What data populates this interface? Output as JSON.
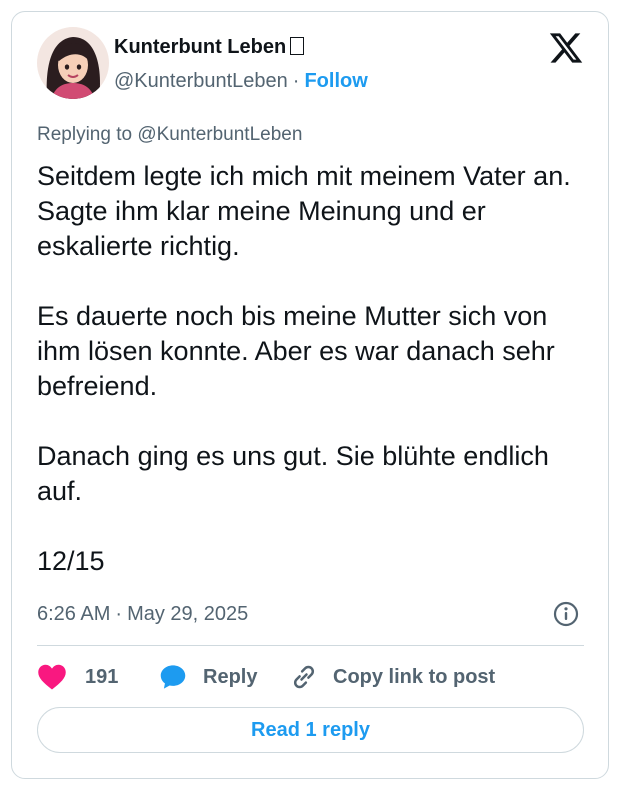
{
  "author": {
    "name": "Kunterbunt Leben",
    "handle": "@KunterbuntLeben",
    "separator": "·",
    "follow_label": "Follow",
    "avatar_icon": "avatar-cartoon-woman"
  },
  "reply_context": "Replying to @KunterbuntLeben",
  "tweet": {
    "paragraphs": [
      "Seitdem legte ich mich mit meinem Vater an. Sagte ihm klar meine Meinung und er eskalierte richtig.",
      "Es dauerte noch bis meine Mutter sich von ihm lösen konnte. Aber es war danach sehr befreiend.",
      "Danach ging es uns gut. Sie blühte endlich auf.",
      "12/15"
    ]
  },
  "meta": {
    "time": "6:26 AM",
    "separator": "·",
    "date": "May 29, 2025"
  },
  "actions": {
    "like_count": "191",
    "reply_label": "Reply",
    "copy_label": "Copy link to post"
  },
  "read_reply_label": "Read 1 reply",
  "colors": {
    "accent": "#1d9bf0",
    "like": "#f91880",
    "muted": "#536471",
    "text": "#0f1419",
    "border": "#cfd9de"
  }
}
